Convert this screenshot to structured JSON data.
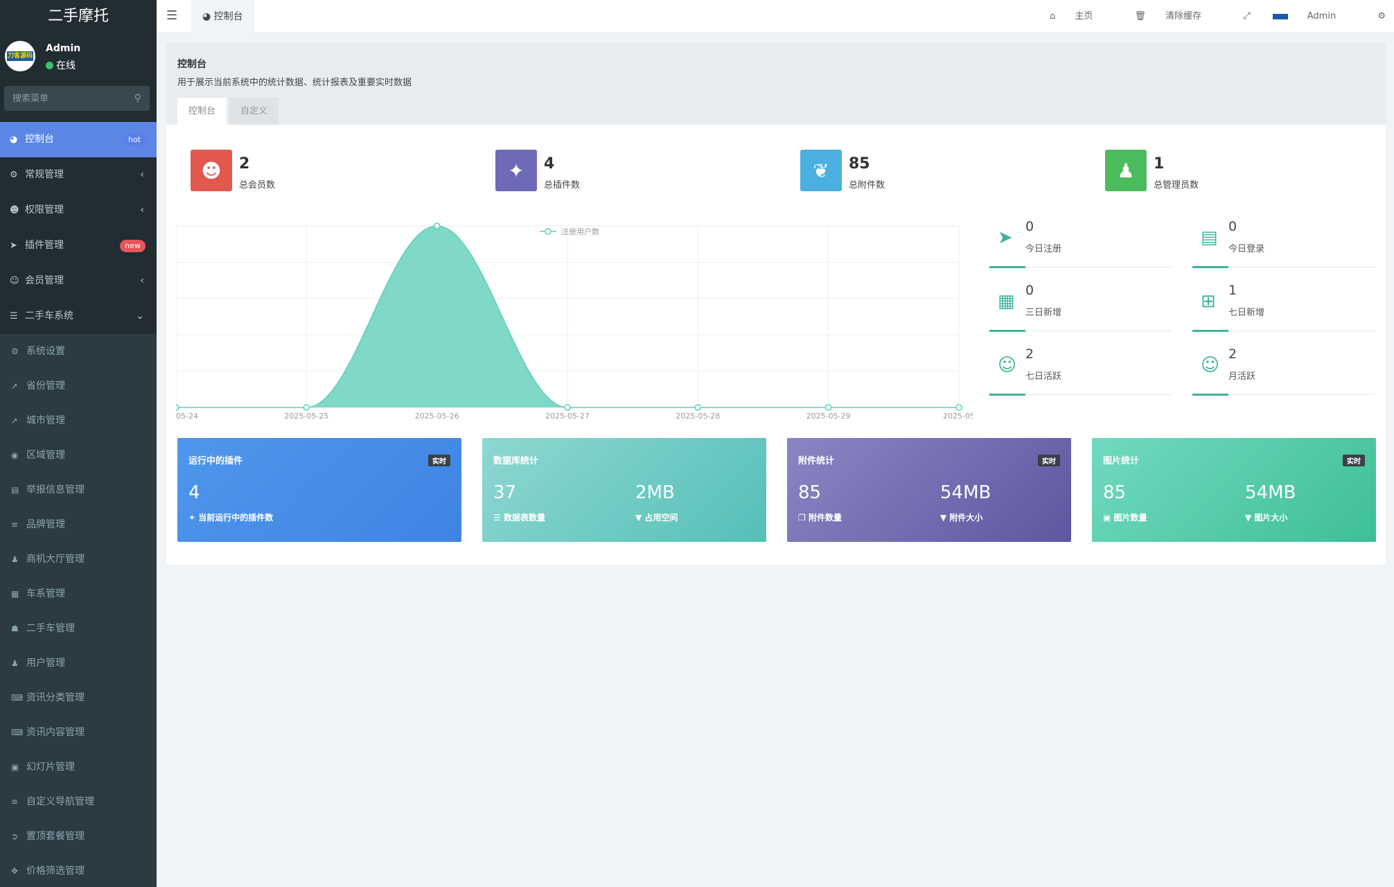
{
  "app": {
    "brand": "二手摩托"
  },
  "user": {
    "name": "Admin",
    "status": "在线",
    "avatar_text": "刀客源码"
  },
  "search": {
    "placeholder": "搜索菜单"
  },
  "menu": [
    {
      "label": "控制台",
      "icon": "dashboard-icon",
      "badge": "hot",
      "active": true
    },
    {
      "label": "常规管理",
      "icon": "cogs-icon"
    },
    {
      "label": "权限管理",
      "icon": "group-icon"
    },
    {
      "label": "插件管理",
      "icon": "rocket-icon",
      "badge": "new"
    },
    {
      "label": "会员管理",
      "icon": "user-circle-icon"
    },
    {
      "label": "二手车系统",
      "icon": "list-icon",
      "expanded": true
    }
  ],
  "submenu": [
    {
      "label": "系统设置",
      "icon": "cogs-icon"
    },
    {
      "label": "省份管理",
      "icon": "location-arrow-icon"
    },
    {
      "label": "城市管理",
      "icon": "location-arrow-icon"
    },
    {
      "label": "区域管理",
      "icon": "dot-circle-icon"
    },
    {
      "label": "举报信息管理",
      "icon": "film-icon"
    },
    {
      "label": "品牌管理",
      "icon": "bars-icon"
    },
    {
      "label": "商机大厅管理",
      "icon": "user-icon"
    },
    {
      "label": "车系管理",
      "icon": "table-icon"
    },
    {
      "label": "二手车管理",
      "icon": "sitemap-icon"
    },
    {
      "label": "用户管理",
      "icon": "user-icon"
    },
    {
      "label": "资讯分类管理",
      "icon": "keyboard-icon"
    },
    {
      "label": "资讯内容管理",
      "icon": "keyboard-icon"
    },
    {
      "label": "幻灯片管理",
      "icon": "image-icon"
    },
    {
      "label": "自定义导航管理",
      "icon": "bars-icon"
    },
    {
      "label": "置顶套餐管理",
      "icon": "chevron-circle-icon"
    },
    {
      "label": "价格筛选管理",
      "icon": "arrows-icon"
    }
  ],
  "topbar": {
    "tab": "控制台",
    "home": "主页",
    "clear_cache": "清除缓存",
    "admin": "Admin"
  },
  "panel": {
    "title": "控制台",
    "desc": "用于展示当前系统中的统计数据、统计报表及重要实时数据",
    "tabs": [
      "控制台",
      "自定义"
    ]
  },
  "stats": [
    {
      "num": "2",
      "label": "总会员数",
      "color": "#e2584e",
      "icon": "users-icon"
    },
    {
      "num": "4",
      "label": "总插件数",
      "color": "#6d6bb8",
      "icon": "magic-icon"
    },
    {
      "num": "85",
      "label": "总附件数",
      "color": "#4bb0e0",
      "icon": "leaf-icon"
    },
    {
      "num": "1",
      "label": "总管理员数",
      "color": "#4cbb5d",
      "icon": "user-icon"
    }
  ],
  "mini_stats": [
    {
      "num": "0",
      "label": "今日注册",
      "icon": "rocket-icon"
    },
    {
      "num": "0",
      "label": "今日登录",
      "icon": "vcard-icon"
    },
    {
      "num": "0",
      "label": "三日新增",
      "icon": "calendar-icon"
    },
    {
      "num": "1",
      "label": "七日新增",
      "icon": "calendar-plus-icon"
    },
    {
      "num": "2",
      "label": "七日活跃",
      "icon": "user-circle-icon"
    },
    {
      "num": "2",
      "label": "月活跃",
      "icon": "user-circle-icon"
    }
  ],
  "cards": [
    {
      "title": "运行中的插件",
      "badge": "实时",
      "num1": "4",
      "sub1": "当前运行中的插件数",
      "num2": "",
      "sub2": ""
    },
    {
      "title": "数据库统计",
      "badge": "",
      "num1": "37",
      "sub1": "数据表数量",
      "num2": "2MB",
      "sub2": "占用空间"
    },
    {
      "title": "附件统计",
      "badge": "实时",
      "num1": "85",
      "sub1": "附件数量",
      "num2": "54MB",
      "sub2": "附件大小"
    },
    {
      "title": "图片统计",
      "badge": "实时",
      "num1": "85",
      "sub1": "图片数量",
      "num2": "54MB",
      "sub2": "图片大小"
    }
  ],
  "chart_data": {
    "type": "area",
    "x": [
      "05-24",
      "2025-05-25",
      "2025-05-26",
      "2025-05-27",
      "2025-05-28",
      "2025-05-29",
      "2025-05"
    ],
    "series": [
      {
        "name": "注册用户数",
        "values": [
          0,
          0,
          2,
          0,
          0,
          0,
          0
        ]
      }
    ],
    "ylim": [
      0,
      2
    ],
    "grid": true,
    "smooth": true,
    "color": "#7fd8c8",
    "legend": "top-center"
  }
}
